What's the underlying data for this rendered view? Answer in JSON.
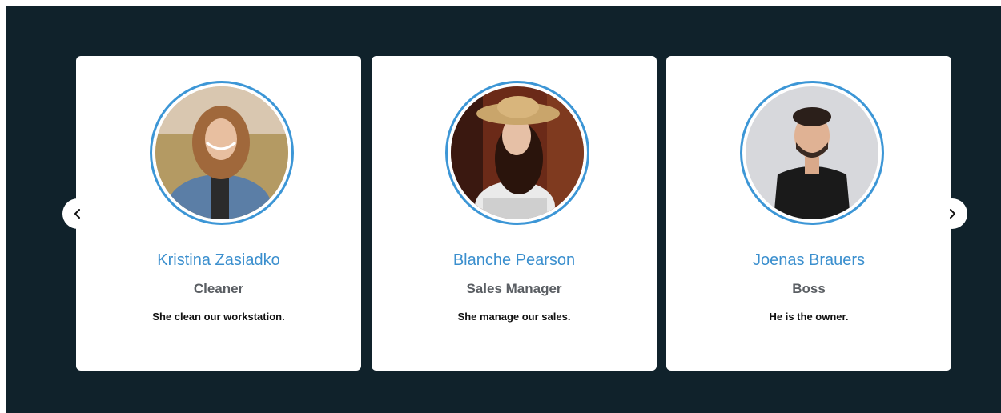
{
  "carousel": {
    "prev_icon": "chevron-left-icon",
    "next_icon": "chevron-right-icon",
    "colors": {
      "background": "#10222b",
      "card": "#ffffff",
      "accent": "#3c96d6",
      "name": "#3b8fce",
      "role": "#5a5e63",
      "description": "#111111"
    },
    "cards": [
      {
        "name": "Kristina Zasiadko",
        "role": "Cleaner",
        "description": "She clean our workstation."
      },
      {
        "name": "Blanche Pearson",
        "role": "Sales Manager",
        "description": "She manage our sales."
      },
      {
        "name": "Joenas Brauers",
        "role": "Boss",
        "description": "He is the owner."
      }
    ]
  }
}
